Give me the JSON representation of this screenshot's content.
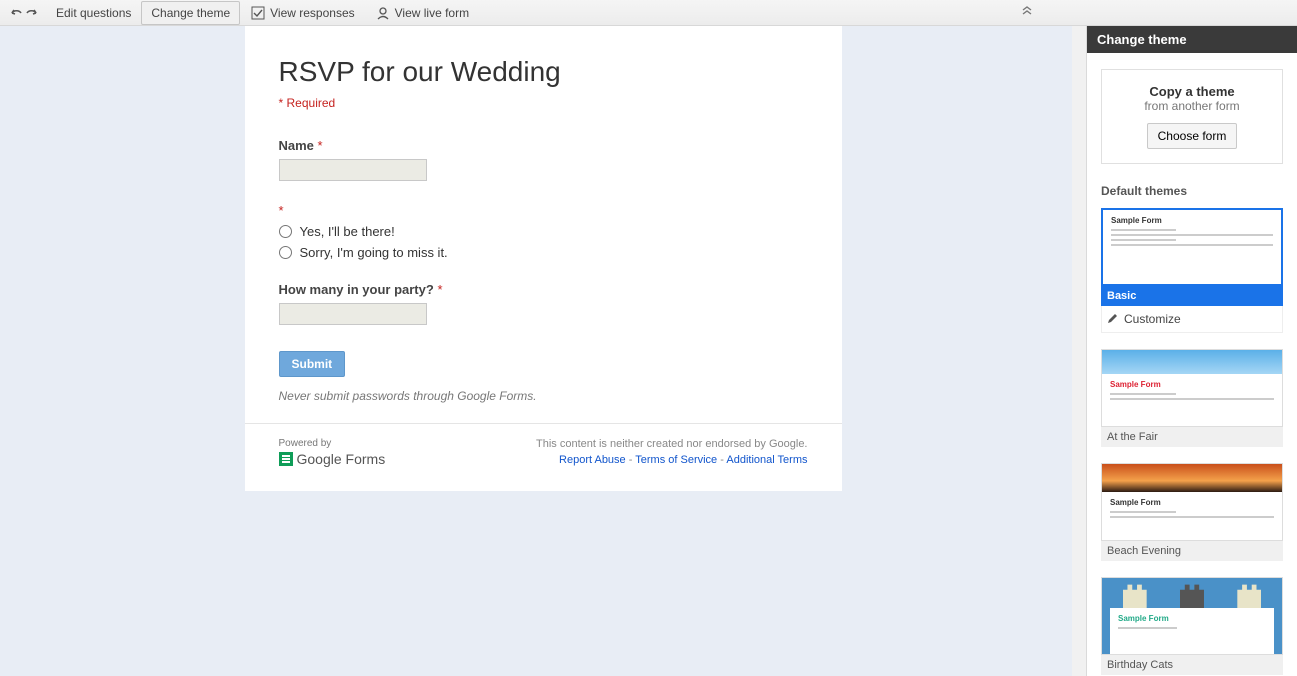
{
  "toolbar": {
    "undo": "↶",
    "redo": "↷",
    "edit_questions": "Edit questions",
    "change_theme": "Change theme",
    "view_responses": "View responses",
    "view_live_form": "View live form"
  },
  "form": {
    "title": "RSVP for our Wedding",
    "required_note": "* Required",
    "q_name": {
      "label": "Name",
      "required": "*"
    },
    "q_attend": {
      "label": "",
      "required": "*",
      "options": [
        "Yes, I'll be there!",
        "Sorry, I'm going to miss it."
      ]
    },
    "q_party": {
      "label": "How many in your party?",
      "required": "*"
    },
    "submit": "Submit",
    "pw_note": "Never submit passwords through Google Forms."
  },
  "footer": {
    "powered_by": "Powered by",
    "google_forms": "Google Forms",
    "disclaimer": "This content is neither created nor endorsed by Google.",
    "report_abuse": "Report Abuse",
    "terms": "Terms of Service",
    "additional": "Additional Terms"
  },
  "sidebar": {
    "title": "Change theme",
    "copy_title": "Copy a theme",
    "copy_sub": "from another form",
    "choose": "Choose form",
    "default_label": "Default themes",
    "customize": "Customize",
    "themes": [
      {
        "name": "Basic",
        "selected": true
      },
      {
        "name": "At the Fair",
        "selected": false
      },
      {
        "name": "Beach Evening",
        "selected": false
      },
      {
        "name": "Birthday Cats",
        "selected": false
      }
    ]
  }
}
